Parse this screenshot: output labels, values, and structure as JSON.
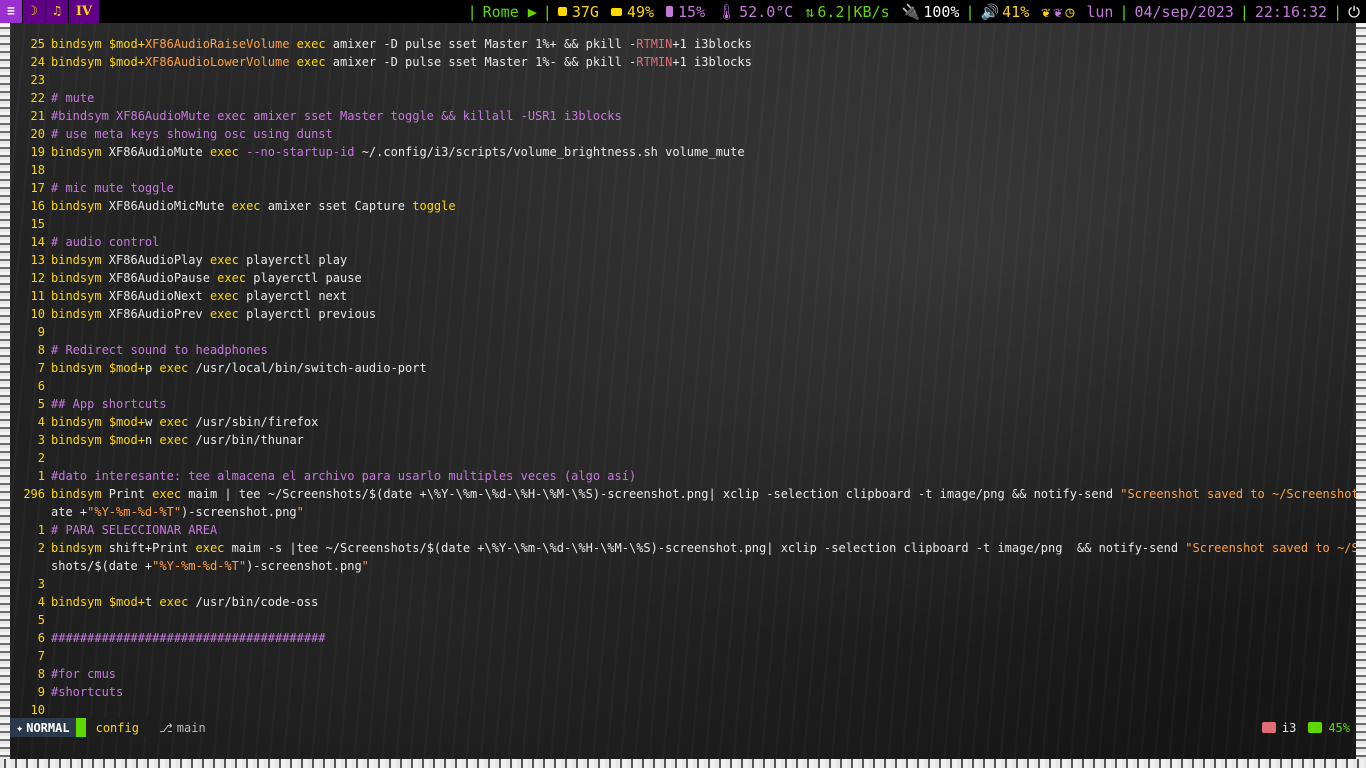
{
  "workspaces": [
    {
      "label": "≡",
      "active": true
    },
    {
      "label": "☽",
      "active": false
    },
    {
      "label": "♫",
      "active": false
    },
    {
      "label": "IV",
      "active": false
    }
  ],
  "status": {
    "location": "Rome ▶",
    "disk": "37G",
    "memory": "49%",
    "cpu": "15%",
    "temp": "52.0°C",
    "net": "6.2|KB/s",
    "battery": "100%",
    "volume": "41%",
    "day": "lun",
    "date": "04/sep/2023",
    "time": "22:16:32"
  },
  "editor": {
    "lines": [
      {
        "n": "25",
        "t": "bindsym $mod+XF86AudioRaiseVolume exec amixer -D pulse sset Master 1%+ && pkill -RTMIN+1 i3blocks"
      },
      {
        "n": "24",
        "t": "bindsym $mod+XF86AudioLowerVolume exec amixer -D pulse sset Master 1%- && pkill -RTMIN+1 i3blocks"
      },
      {
        "n": "23",
        "t": ""
      },
      {
        "n": "22",
        "t": "# mute"
      },
      {
        "n": "21",
        "t": "#bindsym XF86AudioMute exec amixer sset Master toggle && killall -USR1 i3blocks"
      },
      {
        "n": "20",
        "t": "# use meta keys showing osc using dunst"
      },
      {
        "n": "19",
        "t": "bindsym XF86AudioMute exec --no-startup-id ~/.config/i3/scripts/volume_brightness.sh volume_mute"
      },
      {
        "n": "18",
        "t": ""
      },
      {
        "n": "17",
        "t": "# mic mute toggle"
      },
      {
        "n": "16",
        "t": "bindsym XF86AudioMicMute exec amixer sset Capture toggle"
      },
      {
        "n": "15",
        "t": ""
      },
      {
        "n": "14",
        "t": "# audio control"
      },
      {
        "n": "13",
        "t": "bindsym XF86AudioPlay exec playerctl play"
      },
      {
        "n": "12",
        "t": "bindsym XF86AudioPause exec playerctl pause"
      },
      {
        "n": "11",
        "t": "bindsym XF86AudioNext exec playerctl next"
      },
      {
        "n": "10",
        "t": "bindsym XF86AudioPrev exec playerctl previous"
      },
      {
        "n": "9",
        "t": ""
      },
      {
        "n": "8",
        "t": "# Redirect sound to headphones"
      },
      {
        "n": "7",
        "t": "bindsym $mod+p exec /usr/local/bin/switch-audio-port"
      },
      {
        "n": "6",
        "t": ""
      },
      {
        "n": "5",
        "t": "## App shortcuts"
      },
      {
        "n": "4",
        "t": "bindsym $mod+w exec /usr/sbin/firefox"
      },
      {
        "n": "3",
        "t": "bindsym $mod+n exec /usr/bin/thunar"
      },
      {
        "n": "2",
        "t": ""
      },
      {
        "n": "1",
        "t": "#dato interesante: tee almacena el archivo para usarlo multiples veces (algo así)"
      },
      {
        "n": "296",
        "t": "bindsym Print exec maim | tee ~/Screenshots/$(date +\\%Y-\\%m-\\%d-\\%H-\\%M-\\%S)-screenshot.png| xclip -selection clipboard -t image/png && notify-send \"Screenshot saved to ~/Screenshots/$(d",
        "cur": true
      },
      {
        "n": "",
        "t": "ate +\"%Y-%m-%d-%T\")-screenshot.png\""
      },
      {
        "n": "1",
        "t": "# PARA SELECCIONAR AREA"
      },
      {
        "n": "2",
        "t": "bindsym shift+Print exec maim -s |tee ~/Screenshots/$(date +\\%Y-\\%m-\\%d-\\%H-\\%M-\\%S)-screenshot.png| xclip -selection clipboard -t image/png  && notify-send \"Screenshot saved to ~/Screen"
      },
      {
        "n": "",
        "t": "shots/$(date +\"%Y-%m-%d-%T\")-screenshot.png\""
      },
      {
        "n": "3",
        "t": ""
      },
      {
        "n": "4",
        "t": "bindsym $mod+t exec /usr/bin/code-oss"
      },
      {
        "n": "5",
        "t": ""
      },
      {
        "n": "6",
        "t": "######################################"
      },
      {
        "n": "7",
        "t": ""
      },
      {
        "n": "8",
        "t": "#for cmus"
      },
      {
        "n": "9",
        "t": "#shortcuts"
      },
      {
        "n": "10",
        "t": ""
      }
    ]
  },
  "statusline": {
    "mode": "NORMAL",
    "file": "config",
    "branch": "main",
    "filetype": "i3",
    "percent": "45%"
  },
  "colors": {
    "accent": "#5fd700",
    "keyword": "#ffd700",
    "comment": "#c678dd",
    "string": "#ff9f43"
  }
}
